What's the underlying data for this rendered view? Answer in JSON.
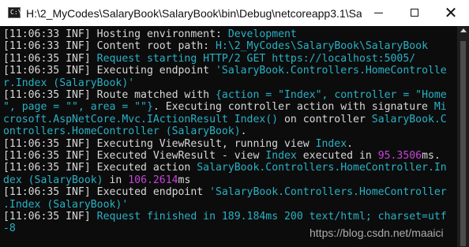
{
  "window": {
    "title": "H:\\2_MyCodes\\SalaryBook\\SalaryBook\\bin\\Debug\\netcoreapp3.1\\Sala...",
    "icon_label": "C:\\",
    "controls": {
      "minimize_icon": "minimize-icon",
      "maximize_icon": "maximize-icon",
      "close_label": "✕"
    }
  },
  "console": {
    "lines": [
      [
        {
          "text": "[11:06:33 INF] Hosting environment: ",
          "color": "gray"
        },
        {
          "text": "Development",
          "color": "cyan"
        }
      ],
      [
        {
          "text": "[11:06:33 INF] Content root path: ",
          "color": "gray"
        },
        {
          "text": "H:\\2_MyCodes\\SalaryBook\\SalaryBook",
          "color": "cyan"
        }
      ],
      [
        {
          "text": "[11:06:35 INF] ",
          "color": "gray"
        },
        {
          "text": "Request starting HTTP/2 GET https://localhost:5005/",
          "color": "cyan"
        }
      ],
      [
        {
          "text": "[11:06:35 INF] Executing endpoint ",
          "color": "gray"
        },
        {
          "text": "'SalaryBook.Controllers.HomeControlle",
          "color": "cyan"
        }
      ],
      [
        {
          "text": "r.Index (SalaryBook)'",
          "color": "cyan"
        }
      ],
      [
        {
          "text": "[11:06:35 INF] Route matched with ",
          "color": "gray"
        },
        {
          "text": "{action = \"Index\", controller = \"Home",
          "color": "cyan"
        }
      ],
      [
        {
          "text": "\", page = \"\", area = \"\"}",
          "color": "cyan"
        },
        {
          "text": ". Executing controller action with signature ",
          "color": "gray"
        },
        {
          "text": "Mi",
          "color": "cyan"
        }
      ],
      [
        {
          "text": "crosoft.AspNetCore.Mvc.IActionResult Index()",
          "color": "cyan"
        },
        {
          "text": " on controller ",
          "color": "gray"
        },
        {
          "text": "SalaryBook.C",
          "color": "cyan"
        }
      ],
      [
        {
          "text": "ontrollers.HomeController (SalaryBook)",
          "color": "cyan"
        },
        {
          "text": ".",
          "color": "gray"
        }
      ],
      [
        {
          "text": "[11:06:35 INF] Executing ViewResult, running view ",
          "color": "gray"
        },
        {
          "text": "Index",
          "color": "cyan"
        },
        {
          "text": ".",
          "color": "gray"
        }
      ],
      [
        {
          "text": "[11:06:35 INF] Executed ViewResult - view ",
          "color": "gray"
        },
        {
          "text": "Index",
          "color": "cyan"
        },
        {
          "text": " executed in ",
          "color": "gray"
        },
        {
          "text": "95.3506",
          "color": "magenta"
        },
        {
          "text": "ms.",
          "color": "gray"
        }
      ],
      [
        {
          "text": "[11:06:35 INF] Executed action ",
          "color": "gray"
        },
        {
          "text": "SalaryBook.Controllers.HomeController.In",
          "color": "cyan"
        }
      ],
      [
        {
          "text": "dex (SalaryBook)",
          "color": "cyan"
        },
        {
          "text": " in ",
          "color": "gray"
        },
        {
          "text": "106.2614",
          "color": "magenta"
        },
        {
          "text": "ms",
          "color": "gray"
        }
      ],
      [
        {
          "text": "[11:06:35 INF] Executed endpoint ",
          "color": "gray"
        },
        {
          "text": "'SalaryBook.Controllers.HomeController",
          "color": "cyan"
        }
      ],
      [
        {
          "text": ".Index (SalaryBook)'",
          "color": "cyan"
        }
      ],
      [
        {
          "text": "[11:06:35 INF] ",
          "color": "gray"
        },
        {
          "text": "Request finished in 189.184ms 200 text/html; charset=utf",
          "color": "cyan"
        }
      ],
      [
        {
          "text": "-8",
          "color": "cyan"
        }
      ]
    ]
  },
  "watermark": "https://blog.csdn.net/maaici",
  "colors": {
    "background": "#0c0c0c",
    "gray": "#d8d8d8",
    "cyan": "#2ab1c6",
    "magenta": "#c743d9",
    "titlebar": "#ffffff"
  }
}
